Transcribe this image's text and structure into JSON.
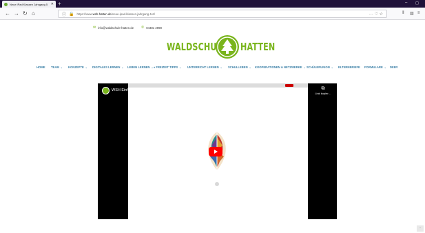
{
  "browser": {
    "tab_title": "Neue iPad Klassen Jahrgang 5",
    "tab_close": "✕",
    "new_tab": "+",
    "url_prefix": "https://www.",
    "url_host": "wsh-hatten.de",
    "url_path": "/neue-ipad-klassen-jahrgang-5-6/",
    "url_more": "··· ♡ ☆"
  },
  "contact": {
    "email": "info@waldschule-hatten.de",
    "phone": "04481 2998"
  },
  "logo": {
    "left": "WALDSCHULE",
    "right": "HATTEN"
  },
  "menu": [
    {
      "label": "HOME",
      "chevron": false
    },
    {
      "label": "TEAM",
      "chevron": true
    },
    {
      "label": "KONZEPTE",
      "chevron": true
    },
    {
      "label": "DIGITALES LERNEN",
      "chevron": true
    },
    {
      "label": "LEBEN LERNEN",
      "chevron": true
    },
    {
      "label": "FREIZEIT TIPPS",
      "chevron": true
    },
    {
      "label": "UNTERRICHT LERNEN",
      "chevron": true
    },
    {
      "label": "SCHULLEBEN",
      "chevron": true
    },
    {
      "label": "KOOPERATIONEN & NETZWERKE",
      "chevron": true
    },
    {
      "label": "SCHÜLERUNION",
      "chevron": true
    },
    {
      "label": "ELTERNBRIEFE",
      "chevron": false
    },
    {
      "label": "FORMULARE",
      "chevron": true
    },
    {
      "label": "DEBV",
      "chevron": false
    }
  ],
  "video": {
    "title": "WSH Einführung iPad",
    "copy_label": "Link kopier…"
  },
  "colors": {
    "brand_green": "#7ab51d",
    "menu_blue": "#3a7fa6",
    "youtube_red": "#ff0000",
    "tabstrip": "#20123a"
  },
  "icons": {
    "back": "arrow-left-icon",
    "forward": "arrow-right-icon",
    "reload": "reload-icon",
    "home": "home-icon",
    "copy": "copy-link-icon",
    "play": "play-icon"
  }
}
